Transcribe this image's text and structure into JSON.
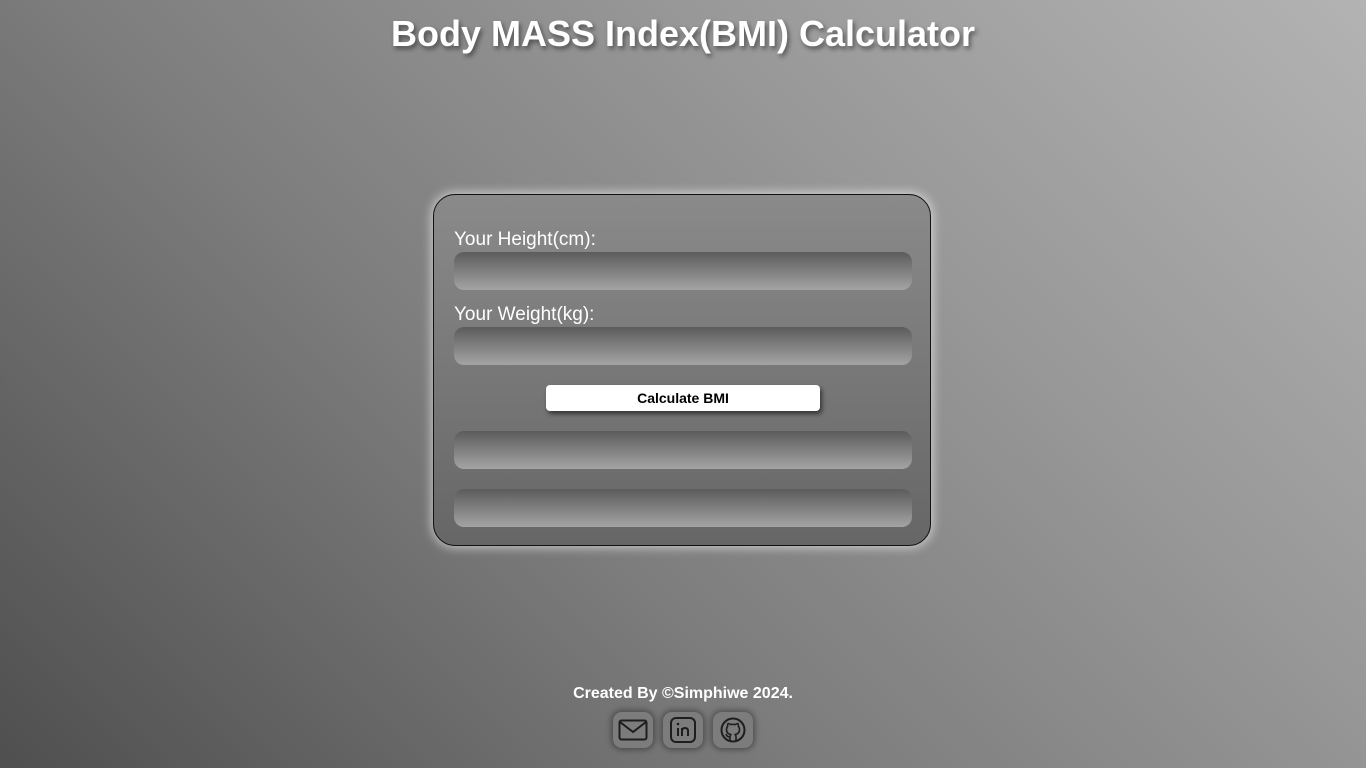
{
  "header": {
    "title": "Body MASS Index(BMI) Calculator"
  },
  "form": {
    "height_label": "Your Height(cm):",
    "height_value": "",
    "weight_label": "Your Weight(kg):",
    "weight_value": "",
    "calculate_label": "Calculate BMI",
    "result_value": "",
    "category_value": ""
  },
  "footer": {
    "credit": "Created By ©Simphiwe 2024.",
    "social": [
      {
        "icon": "mail-icon"
      },
      {
        "icon": "linkedin-icon"
      },
      {
        "icon": "github-icon"
      }
    ]
  },
  "colors": {
    "button_bg": "#ffffff",
    "text": "#ffffff"
  }
}
